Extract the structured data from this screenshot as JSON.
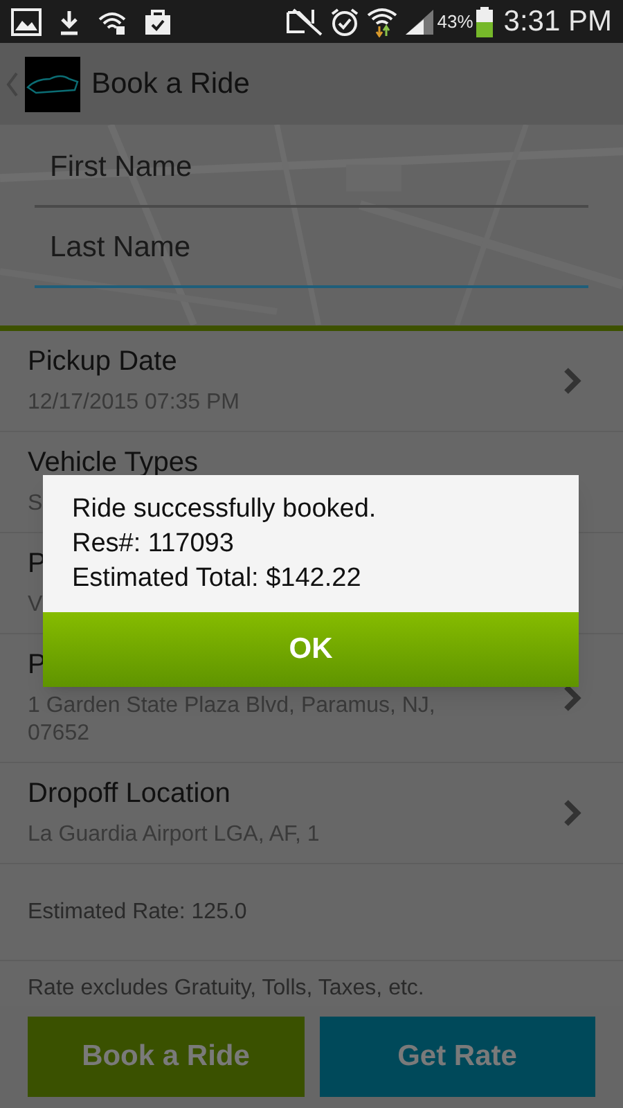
{
  "status_bar": {
    "battery": "43%",
    "time": "3:31 PM"
  },
  "app_bar": {
    "title": "Book a Ride"
  },
  "fields": [
    {
      "placeholder": "First Name",
      "focused": false
    },
    {
      "placeholder": "Last Name",
      "focused": true
    }
  ],
  "rows": [
    {
      "title": "Pickup Date",
      "value": "12/17/2015 07:35 PM",
      "chevron": true
    },
    {
      "title": "Vehicle Types",
      "value": "S",
      "chevron": false
    },
    {
      "title": "P",
      "value": "V",
      "chevron": false
    },
    {
      "title": "P",
      "value": "1 Garden State Plaza Blvd, Paramus, NJ, 07652",
      "chevron": true
    },
    {
      "title": "Dropoff Location",
      "value": "La Guardia Airport LGA, AF, 1",
      "chevron": true
    }
  ],
  "estimated_rate": "Estimated Rate: 125.0",
  "note": "Rate excludes Gratuity, Tolls, Taxes, etc.",
  "buttons": [
    {
      "label": "Book a Ride",
      "kind": "book"
    },
    {
      "label": "Get Rate",
      "kind": "rate"
    }
  ],
  "dialog": {
    "lines": [
      "Ride successfully booked.",
      "Res#: 117093",
      "Estimated Total: $142.22"
    ],
    "button": "OK"
  }
}
